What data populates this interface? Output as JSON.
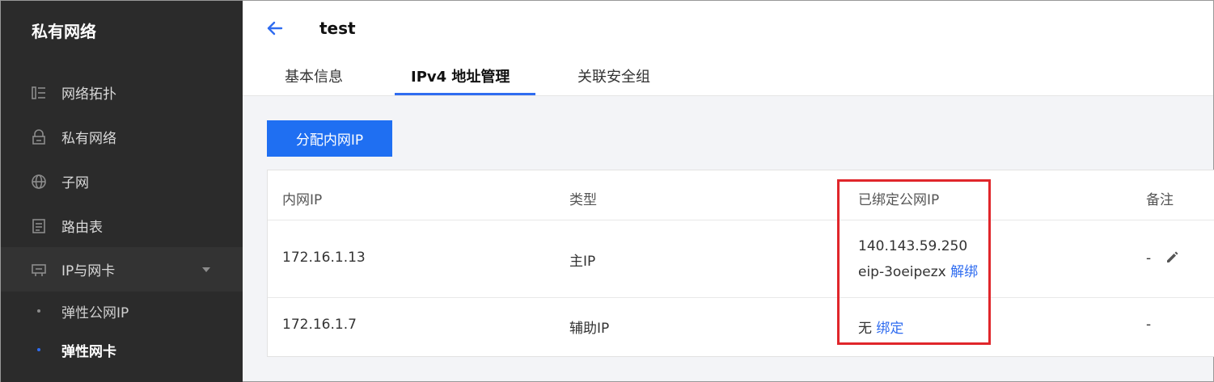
{
  "sidebar": {
    "title": "私有网络",
    "items": [
      {
        "label": "网络拓扑",
        "icon": "topology-icon"
      },
      {
        "label": "私有网络",
        "icon": "lock-icon"
      },
      {
        "label": "子网",
        "icon": "globe-icon"
      },
      {
        "label": "路由表",
        "icon": "route-table-icon"
      },
      {
        "label": "IP与网卡",
        "icon": "nic-icon",
        "expanded": true
      }
    ],
    "subitems": [
      {
        "label": "弹性公网IP",
        "active": false
      },
      {
        "label": "弹性网卡",
        "active": true
      }
    ]
  },
  "header": {
    "title": "test",
    "tabs": [
      {
        "label": "基本信息",
        "active": false
      },
      {
        "label": "IPv4 地址管理",
        "active": true
      },
      {
        "label": "关联安全组",
        "active": false
      }
    ]
  },
  "toolbar": {
    "allocate_label": "分配内网IP"
  },
  "table": {
    "columns": [
      "内网IP",
      "类型",
      "已绑定公网IP",
      "备注"
    ],
    "rows": [
      {
        "private_ip": "172.16.1.13",
        "type": "主IP",
        "public_ip": "140.143.59.250",
        "eip_id": "eip-3oeipezx",
        "action": "解绑",
        "remark": "-"
      },
      {
        "private_ip": "172.16.1.7",
        "type": "辅助IP",
        "public_ip_none": "无",
        "action": "绑定",
        "remark": "-"
      }
    ]
  },
  "colors": {
    "sidebar_bg": "#2b2b2b",
    "accent": "#1f6ff2",
    "highlight": "#e0262b"
  }
}
